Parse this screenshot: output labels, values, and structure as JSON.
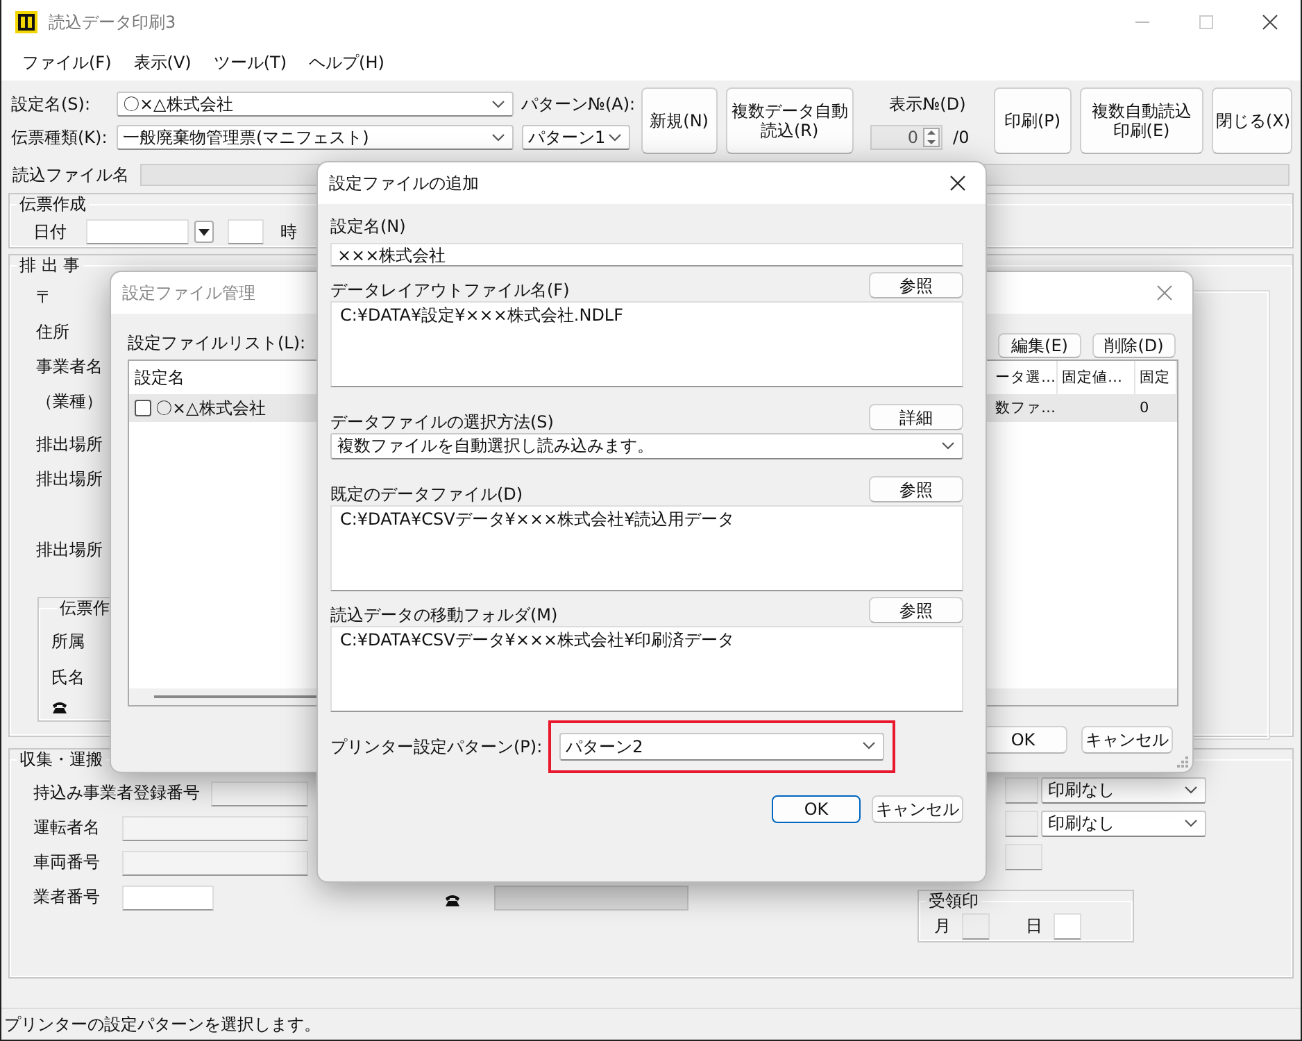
{
  "window": {
    "title": "読込データ印刷3"
  },
  "menu": [
    "ファイル(F)",
    "表示(V)",
    "ツール(T)",
    "ヘルプ(H)"
  ],
  "toolbar": {
    "fields": [
      {
        "label": "設定名(S):",
        "value": "〇×△株式会社"
      },
      {
        "label": "伝票種類(K):",
        "value": "一般廃棄物管理票(マニフェスト)"
      }
    ],
    "pattern": {
      "label": "パターン№(A):",
      "value": "パターン1"
    },
    "buttons_left": [
      "新規(N)",
      "複数データ自動読込(R)"
    ],
    "display_no": {
      "label": "表示№(D)",
      "value": "0",
      "total": "/0",
      "disabled": true
    },
    "buttons_right": [
      "印刷(P)",
      "複数自動読込印刷(E)",
      "閉じる(X)"
    ]
  },
  "read_file": {
    "label": "読込ファイル名"
  },
  "slip_group": {
    "title": "伝票作成",
    "date_label": "日付",
    "hour_label": "時"
  },
  "discharger_group": {
    "title": "排 出 事",
    "labels": [
      "〒",
      "住所",
      "事業者名",
      "（業種）",
      "排出場所",
      "排出場所",
      "排出場所"
    ],
    "creator_group": {
      "title": "伝票作",
      "labels": [
        "所属",
        "氏名"
      ]
    }
  },
  "carrier_group": {
    "title": "収集・運搬",
    "rows": [
      {
        "label": "持込み事業者登録番号"
      },
      {
        "label": "運転者名"
      },
      {
        "label": "車両番号"
      },
      {
        "label": "業者番号"
      }
    ],
    "print_options": [
      "印刷なし",
      "印刷なし"
    ],
    "receipt": {
      "title": "受領印",
      "month_label": "月",
      "day_label": "日"
    }
  },
  "status_bar": "プリンターの設定パターンを選択します。",
  "manager_dialog": {
    "title": "設定ファイル管理",
    "list_label": "設定ファイルリスト(L):",
    "buttons": [
      "編集(E)",
      "削除(D)"
    ],
    "columns": [
      "設定名",
      "ータ選…",
      "固定値…",
      "固定"
    ],
    "rows": [
      {
        "checked": false,
        "selected": true,
        "name": "〇×△株式会社",
        "column_2": "数ファ…",
        "column_4": "0"
      }
    ],
    "footer_buttons": [
      "OK",
      "キャンセル"
    ]
  },
  "add_dialog": {
    "title": "設定ファイルの追加",
    "name_field": {
      "label": "設定名(N)",
      "value": "×××株式会社"
    },
    "sections": [
      {
        "kind": "path",
        "label": "データレイアウトファイル名(F)",
        "button": "参照",
        "value": "C:¥DATA¥設定¥×××株式会社.NDLF"
      },
      {
        "kind": "select",
        "label": "データファイルの選択方法(S)",
        "button": "詳細",
        "value": "複数ファイルを自動選択し読み込みます。"
      },
      {
        "kind": "path",
        "label": "既定のデータファイル(D)",
        "button": "参照",
        "value": "C:¥DATA¥CSVデータ¥×××株式会社¥読込用データ"
      },
      {
        "kind": "path",
        "label": "読込データの移動フォルダ(M)",
        "button": "参照",
        "value": "C:¥DATA¥CSVデータ¥×××株式会社¥印刷済データ"
      }
    ],
    "printer": {
      "label": "プリンター設定パターン(P):",
      "value": "パターン2",
      "highlighted": true
    },
    "buttons": [
      {
        "label": "OK",
        "default": true
      },
      {
        "label": "キャンセル",
        "default": false
      }
    ]
  }
}
